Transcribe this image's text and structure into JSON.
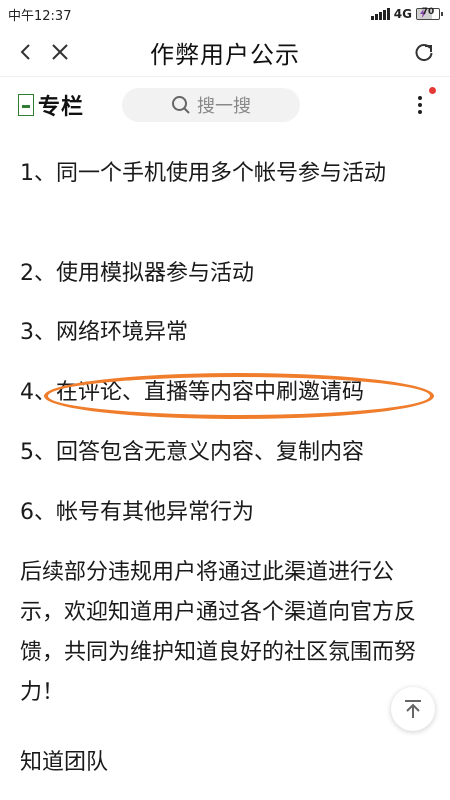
{
  "status_bar": {
    "time": "中午12:37",
    "network": "4G",
    "battery": "70",
    "battery_level": 0.7
  },
  "title_bar": {
    "title": "作弊用户公示",
    "icons": [
      "back-arrow-icon",
      "close-icon",
      "refresh-icon"
    ]
  },
  "sub_header": {
    "logo_text": "专栏",
    "search_placeholder": "搜一搜",
    "icons": [
      "search-icon",
      "more-vertical-icon"
    ],
    "notification_color": "#e53935"
  },
  "content": {
    "items": [
      "1、同一个手机使用多个帐号参与活动",
      "2、使用模拟器参与活动",
      "3、网络环境异常",
      "4、在评论、直播等内容中刷邀请码",
      "5、回答包含无意义内容、复制内容",
      "6、帐号有其他异常行为"
    ],
    "closing": "后续部分违规用户将通过此渠道进行公示，欢迎知道用户通过各个渠道向官方反馈，共同为维护知道良好的社区氛围而努力！",
    "signature": "知道团队"
  },
  "colors": {
    "highlight": "#ef7d2c",
    "logo_green": "#2e7d32"
  },
  "back_to_top_icon": "arrow-up-to-top-icon"
}
